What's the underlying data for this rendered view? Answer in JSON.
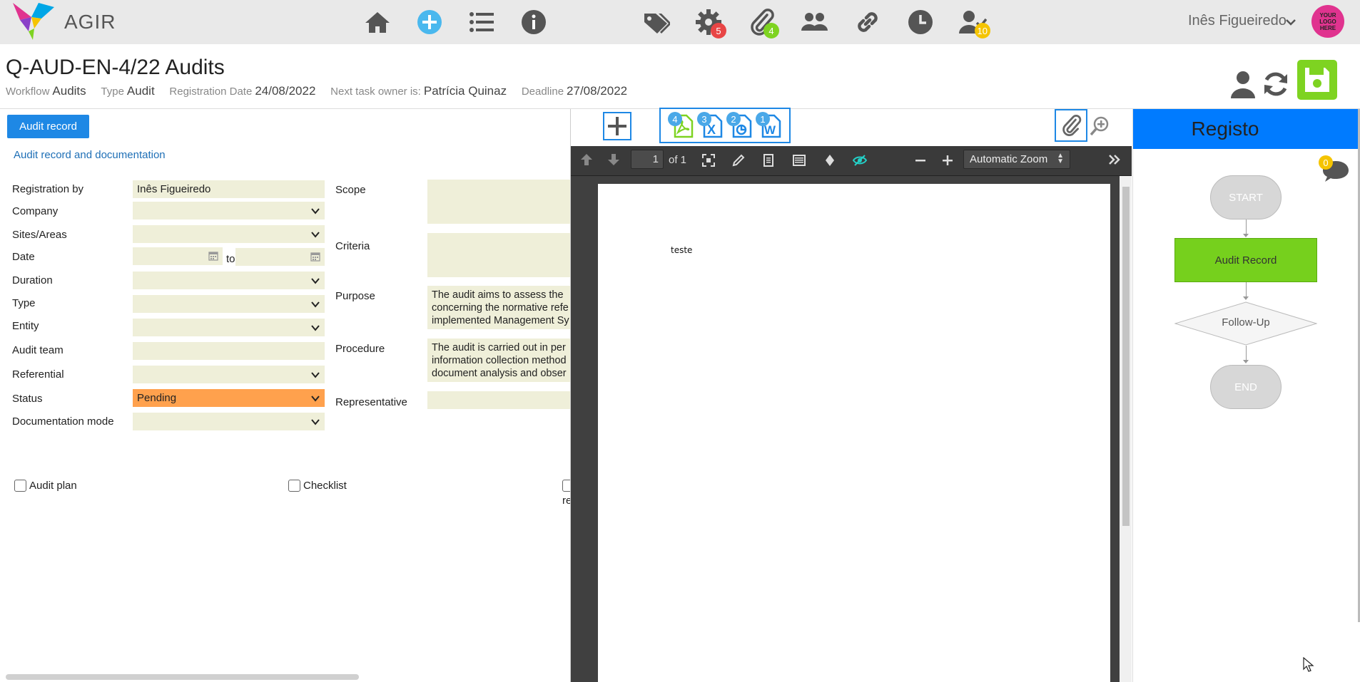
{
  "app": {
    "brand": "AGIR"
  },
  "topbar": {
    "badges": {
      "settings": "5",
      "attachments": "4",
      "tasks": "10"
    },
    "user_name": "Inês Figueiredo",
    "logo_text": "YOUR LOGO HERE"
  },
  "header": {
    "title": "Q-AUD-EN-4/22 Audits",
    "workflow_label": "Workflow",
    "workflow_value": "Audits",
    "type_label": "Type",
    "type_value": "Audit",
    "reg_date_label": "Registration Date",
    "reg_date_value": "24/08/2022",
    "owner_label": "Next task owner is:",
    "owner_value": "Patrícia Quinaz",
    "deadline_label": "Deadline",
    "deadline_value": "27/08/2022"
  },
  "form": {
    "tab_label": "Audit record",
    "section_link": "Audit record and documentation",
    "labels": {
      "registration_by": "Registration by",
      "company": "Company",
      "sites": "Sites/Areas",
      "date": "Date",
      "to": "to",
      "duration": "Duration",
      "type": "Type",
      "entity": "Entity",
      "audit_team": "Audit team",
      "referential": "Referential",
      "status": "Status",
      "doc_mode": "Documentation mode",
      "scope": "Scope",
      "criteria": "Criteria",
      "purpose": "Purpose",
      "procedure": "Procedure",
      "representative": "Representative"
    },
    "values": {
      "registration_by": "Inês Figueiredo",
      "status": "Pending",
      "purpose_l1": "The audit aims to assess the",
      "purpose_l2": "concerning the normative refe",
      "purpose_l3": "implemented Management Sy",
      "procedure_l1": "The audit is carried out in per",
      "procedure_l2": "information collection method",
      "procedure_l3": "document analysis and obser"
    },
    "checkboxes": {
      "audit_plan": "Audit plan",
      "checklist": "Checklist",
      "third_partial": "re"
    }
  },
  "docs": {
    "badges": {
      "pdf": "4",
      "excel": "3",
      "ppt": "2",
      "word": "1"
    },
    "pdf": {
      "page": "1",
      "of": "of 1",
      "zoom": "Automatic Zoom",
      "page_text": "teste"
    }
  },
  "workflow": {
    "title": "Registo",
    "chat_badge": "0",
    "nodes": {
      "start": "START",
      "audit": "Audit Record",
      "follow": "Follow-Up",
      "end": "END"
    }
  },
  "colors": {
    "accent": "#1e88e5",
    "save": "#7ed321",
    "status_pending": "#ffa14d",
    "field_bg": "#efefd9",
    "wf_header": "#007bff"
  }
}
